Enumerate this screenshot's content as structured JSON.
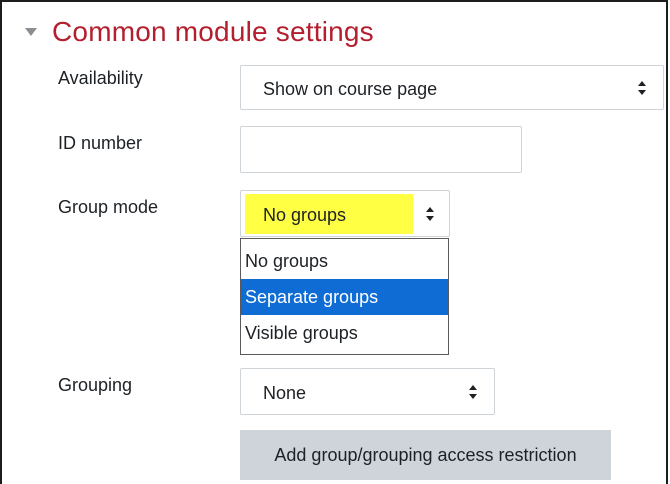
{
  "section": {
    "title": "Common module settings",
    "collapse_icon": "caret-down-icon"
  },
  "availability": {
    "label": "Availability",
    "value": "Show on course page"
  },
  "id_number": {
    "label": "ID number",
    "value": ""
  },
  "group_mode": {
    "label": "Group mode",
    "value": "No groups",
    "options": [
      "No groups",
      "Separate groups",
      "Visible groups"
    ],
    "highlighted_option": "Separate groups"
  },
  "grouping": {
    "label": "Grouping",
    "value": "None"
  },
  "restriction_button": {
    "label": "Add group/grouping access restriction"
  },
  "colors": {
    "title": "#b31f2e",
    "highlight": "#ffff44",
    "selected_option": "#0f6cd4",
    "button_bg": "#ced4da"
  }
}
